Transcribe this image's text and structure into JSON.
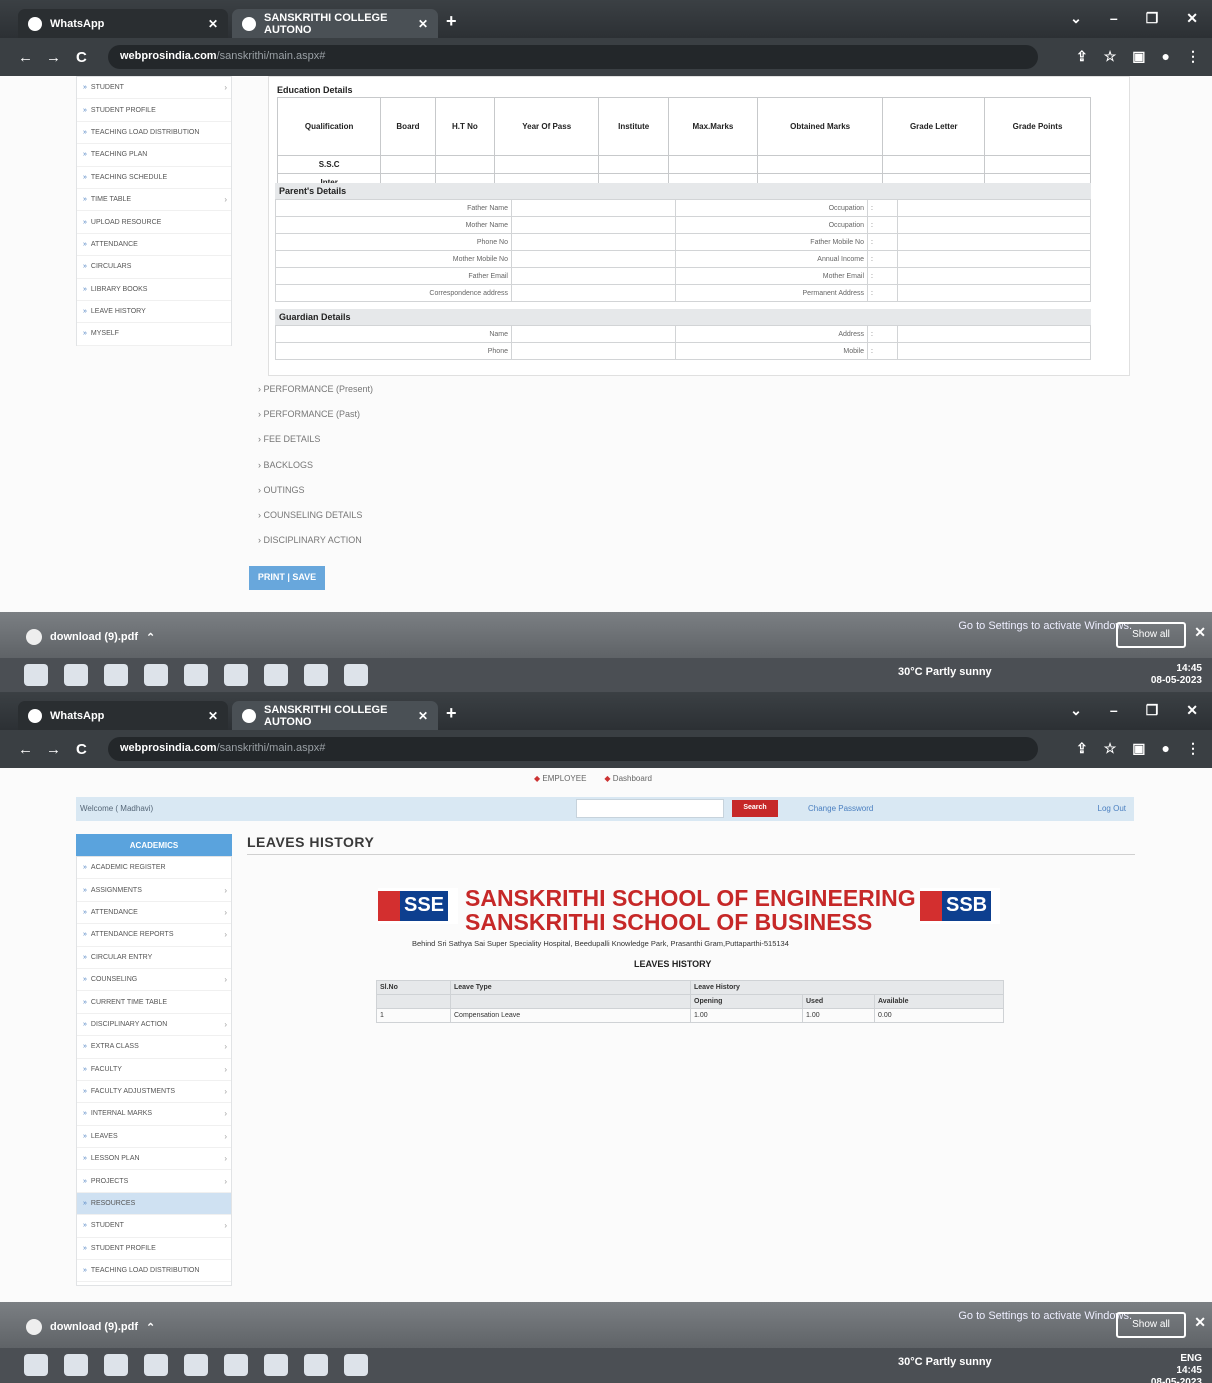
{
  "browser": {
    "tab1_title": "WhatsApp",
    "tab2_title": "SANSKRITHI COLLEGE AUTONO",
    "new_tab": "+",
    "url_domain": "webprosindia.com",
    "url_path": "/sanskrithi/main.aspx#",
    "nav_back": "←",
    "nav_forward": "→",
    "nav_reload": "C"
  },
  "top_screen": {
    "sidebar": [
      "STUDENT",
      "STUDENT PROFILE",
      "TEACHING LOAD DISTRIBUTION",
      "TEACHING PLAN",
      "TEACHING SCHEDULE",
      "TIME TABLE",
      "UPLOAD RESOURCE",
      "ATTENDANCE",
      "CIRCULARS",
      "LIBRARY BOOKS",
      "LEAVE HISTORY",
      "MYSELF"
    ],
    "education": {
      "title": "Education Details",
      "headers": [
        "Qualification",
        "Board",
        "H.T No",
        "Year Of Pass",
        "Institute",
        "Max.Marks",
        "Obtained Marks",
        "Grade Letter",
        "Grade Points"
      ],
      "rows": [
        "S.S.C",
        "Inter"
      ]
    },
    "parents": {
      "title": "Parent's Details",
      "left_labels": [
        "Father Name",
        "Mother Name",
        "Phone No",
        "Mother Mobile No",
        "Father Email",
        "Correspondence address"
      ],
      "right_labels": [
        "Occupation",
        "Occupation",
        "Father Mobile No",
        "Annual Income",
        "Mother Email",
        "Permanent Address"
      ]
    },
    "guardian": {
      "title": "Guardian Details",
      "left_labels": [
        "Name",
        "Phone"
      ],
      "right_labels": [
        "Address",
        "Mobile"
      ]
    },
    "links": [
      "PERFORMANCE (Present)",
      "PERFORMANCE (Past)",
      "FEE DETAILS",
      "BACKLOGS",
      "OUTINGS",
      "COUNSELING DETAILS",
      "DISCIPLINARY ACTION"
    ],
    "print_label": "PRINT | SAVE"
  },
  "taskbar": {
    "download_item": "download (9).pdf",
    "activate_text": "Go to Settings to activate Windows.",
    "show_all": "Show all",
    "weather": "30°C Partly sunny",
    "time": "14:45",
    "date": "08-05-2023",
    "lang": "ENG"
  },
  "bottom_screen": {
    "crumbs": [
      "EMPLOYEE",
      "Dashboard"
    ],
    "welcome": "Welcome ( Madhavi)",
    "search_btn": "Search",
    "change_password": "Change Password",
    "logout": "Log Out",
    "academics": "ACADEMICS",
    "page_title": "LEAVES HISTORY",
    "logo_left": "SSE",
    "logo_right": "SSB",
    "school_line1": "SANSKRITHI SCHOOL OF ENGINEERING",
    "school_line2": "SANSKRITHI SCHOOL OF BUSINESS",
    "address": "Behind Sri Sathya Sai Super Speciality Hospital, Beedupalli Knowledge Park, Prasanthi Gram,Puttaparthi-515134",
    "table_title": "LEAVES HISTORY",
    "table": {
      "h_slno": "Sl.No",
      "h_type": "Leave Type",
      "h_history": "Leave History",
      "h_opening": "Opening",
      "h_used": "Used",
      "h_available": "Available",
      "row": {
        "slno": "1",
        "type": "Compensation Leave",
        "opening": "1.00",
        "used": "1.00",
        "available": "0.00"
      }
    },
    "sidebar": [
      "ACADEMIC REGISTER",
      "ASSIGNMENTS",
      "ATTENDANCE",
      "ATTENDANCE REPORTS",
      "CIRCULAR ENTRY",
      "COUNSELING",
      "CURRENT TIME TABLE",
      "DISCIPLINARY ACTION",
      "EXTRA CLASS",
      "FACULTY",
      "FACULTY ADJUSTMENTS",
      "INTERNAL MARKS",
      "LEAVES",
      "LESSON PLAN",
      "PROJECTS",
      "RESOURCES",
      "STUDENT",
      "STUDENT PROFILE",
      "TEACHING LOAD DISTRIBUTION"
    ]
  }
}
